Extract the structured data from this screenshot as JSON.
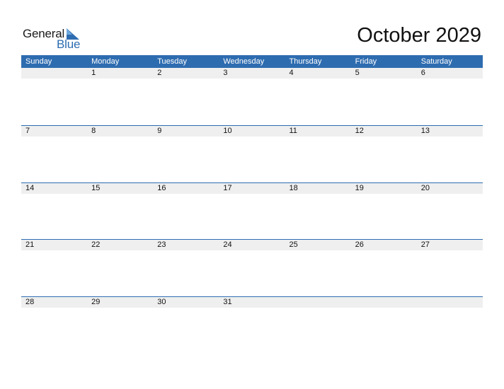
{
  "logo": {
    "word1": "General",
    "word2": "Blue",
    "icon": "triangle-flag-icon",
    "accent": "#2e6cb0"
  },
  "title": "October 2029",
  "colors": {
    "header_bg": "#2e6cb0",
    "header_text": "#ffffff",
    "day_band": "#efefef"
  },
  "weekdays": [
    "Sunday",
    "Monday",
    "Tuesday",
    "Wednesday",
    "Thursday",
    "Friday",
    "Saturday"
  ],
  "weeks": [
    [
      "",
      "1",
      "2",
      "3",
      "4",
      "5",
      "6"
    ],
    [
      "7",
      "8",
      "9",
      "10",
      "11",
      "12",
      "13"
    ],
    [
      "14",
      "15",
      "16",
      "17",
      "18",
      "19",
      "20"
    ],
    [
      "21",
      "22",
      "23",
      "24",
      "25",
      "26",
      "27"
    ],
    [
      "28",
      "29",
      "30",
      "31",
      "",
      "",
      ""
    ]
  ]
}
